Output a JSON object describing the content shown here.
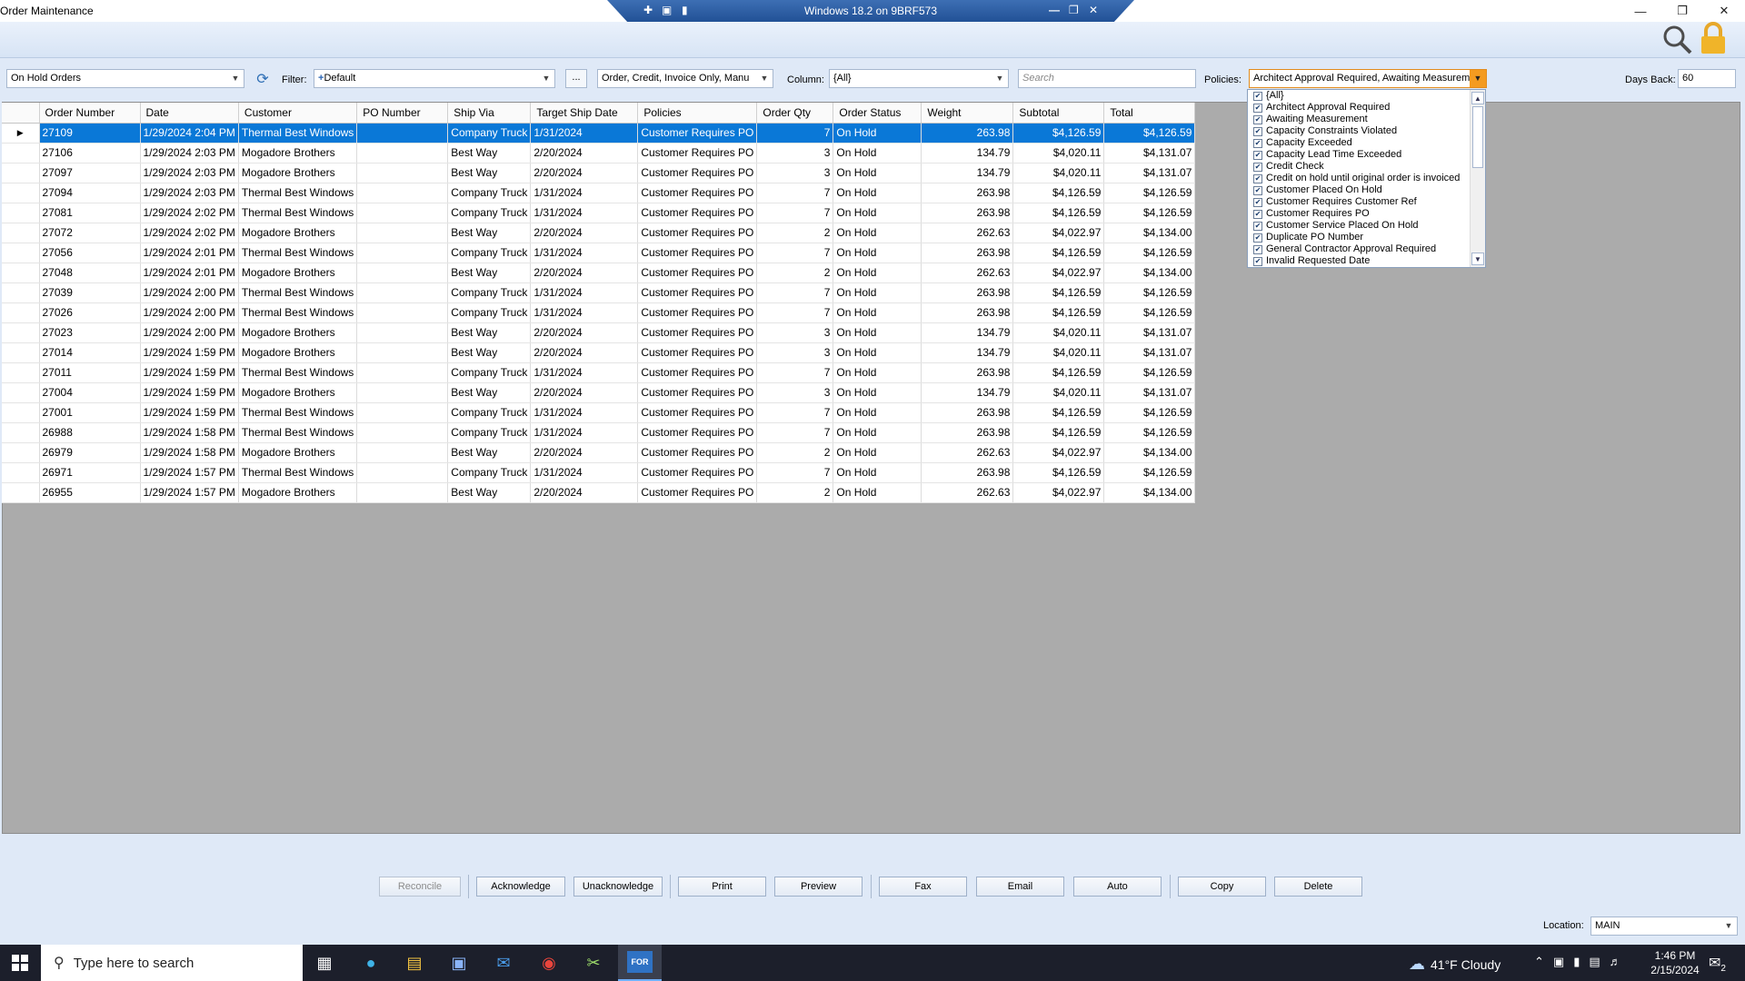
{
  "window": {
    "title": "Order Maintenance"
  },
  "remote_bar": {
    "title": "Windows 18.2 on 9BRF573"
  },
  "toolbar": {
    "view": "On Hold Orders",
    "filter_label": "Filter:",
    "filter_value": "Default",
    "ellipsis": "...",
    "types": "Order, Credit, Invoice Only, Manu",
    "column_label": "Column:",
    "column_value": "{All}",
    "search_placeholder": "Search",
    "policies_label": "Policies:",
    "policies_value": "Architect Approval Required, Awaiting Measurement",
    "days_back_label": "Days Back:",
    "days_back_value": "60"
  },
  "policies_list": [
    "{All}",
    "Architect Approval Required",
    "Awaiting Measurement",
    "Capacity Constraints Violated",
    "Capacity Exceeded",
    "Capacity Lead Time Exceeded",
    "Credit Check",
    "Credit on hold until original order is invoiced",
    "Customer Placed On Hold",
    "Customer Requires Customer Ref",
    "Customer Requires PO",
    "Customer Service Placed On Hold",
    "Duplicate PO Number",
    "General Contractor Approval Required",
    "Invalid Requested Date"
  ],
  "grid": {
    "columns": [
      "Order Number",
      "Date",
      "Customer",
      "PO Number",
      "Ship Via",
      "Target Ship Date",
      "Policies",
      "Order Qty",
      "Order Status",
      "Weight",
      "Subtotal",
      "Total"
    ],
    "rows": [
      [
        "27109",
        "1/29/2024 2:04 PM",
        "Thermal Best Windows",
        "",
        "Company Truck",
        "1/31/2024",
        "Customer Requires PO",
        "7",
        "On Hold",
        "263.98",
        "$4,126.59",
        "$4,126.59"
      ],
      [
        "27106",
        "1/29/2024 2:03 PM",
        "Mogadore Brothers",
        "",
        "Best Way",
        "2/20/2024",
        "Customer Requires PO",
        "3",
        "On Hold",
        "134.79",
        "$4,020.11",
        "$4,131.07"
      ],
      [
        "27097",
        "1/29/2024 2:03 PM",
        "Mogadore Brothers",
        "",
        "Best Way",
        "2/20/2024",
        "Customer Requires PO",
        "3",
        "On Hold",
        "134.79",
        "$4,020.11",
        "$4,131.07"
      ],
      [
        "27094",
        "1/29/2024 2:03 PM",
        "Thermal Best Windows",
        "",
        "Company Truck",
        "1/31/2024",
        "Customer Requires PO",
        "7",
        "On Hold",
        "263.98",
        "$4,126.59",
        "$4,126.59"
      ],
      [
        "27081",
        "1/29/2024 2:02 PM",
        "Thermal Best Windows",
        "",
        "Company Truck",
        "1/31/2024",
        "Customer Requires PO",
        "7",
        "On Hold",
        "263.98",
        "$4,126.59",
        "$4,126.59"
      ],
      [
        "27072",
        "1/29/2024 2:02 PM",
        "Mogadore Brothers",
        "",
        "Best Way",
        "2/20/2024",
        "Customer Requires PO",
        "2",
        "On Hold",
        "262.63",
        "$4,022.97",
        "$4,134.00"
      ],
      [
        "27056",
        "1/29/2024 2:01 PM",
        "Thermal Best Windows",
        "",
        "Company Truck",
        "1/31/2024",
        "Customer Requires PO",
        "7",
        "On Hold",
        "263.98",
        "$4,126.59",
        "$4,126.59"
      ],
      [
        "27048",
        "1/29/2024 2:01 PM",
        "Mogadore Brothers",
        "",
        "Best Way",
        "2/20/2024",
        "Customer Requires PO",
        "2",
        "On Hold",
        "262.63",
        "$4,022.97",
        "$4,134.00"
      ],
      [
        "27039",
        "1/29/2024 2:00 PM",
        "Thermal Best Windows",
        "",
        "Company Truck",
        "1/31/2024",
        "Customer Requires PO",
        "7",
        "On Hold",
        "263.98",
        "$4,126.59",
        "$4,126.59"
      ],
      [
        "27026",
        "1/29/2024 2:00 PM",
        "Thermal Best Windows",
        "",
        "Company Truck",
        "1/31/2024",
        "Customer Requires PO",
        "7",
        "On Hold",
        "263.98",
        "$4,126.59",
        "$4,126.59"
      ],
      [
        "27023",
        "1/29/2024 2:00 PM",
        "Mogadore Brothers",
        "",
        "Best Way",
        "2/20/2024",
        "Customer Requires PO",
        "3",
        "On Hold",
        "134.79",
        "$4,020.11",
        "$4,131.07"
      ],
      [
        "27014",
        "1/29/2024 1:59 PM",
        "Mogadore Brothers",
        "",
        "Best Way",
        "2/20/2024",
        "Customer Requires PO",
        "3",
        "On Hold",
        "134.79",
        "$4,020.11",
        "$4,131.07"
      ],
      [
        "27011",
        "1/29/2024 1:59 PM",
        "Thermal Best Windows",
        "",
        "Company Truck",
        "1/31/2024",
        "Customer Requires PO",
        "7",
        "On Hold",
        "263.98",
        "$4,126.59",
        "$4,126.59"
      ],
      [
        "27004",
        "1/29/2024 1:59 PM",
        "Mogadore Brothers",
        "",
        "Best Way",
        "2/20/2024",
        "Customer Requires PO",
        "3",
        "On Hold",
        "134.79",
        "$4,020.11",
        "$4,131.07"
      ],
      [
        "27001",
        "1/29/2024 1:59 PM",
        "Thermal Best Windows",
        "",
        "Company Truck",
        "1/31/2024",
        "Customer Requires PO",
        "7",
        "On Hold",
        "263.98",
        "$4,126.59",
        "$4,126.59"
      ],
      [
        "26988",
        "1/29/2024 1:58 PM",
        "Thermal Best Windows",
        "",
        "Company Truck",
        "1/31/2024",
        "Customer Requires PO",
        "7",
        "On Hold",
        "263.98",
        "$4,126.59",
        "$4,126.59"
      ],
      [
        "26979",
        "1/29/2024 1:58 PM",
        "Mogadore Brothers",
        "",
        "Best Way",
        "2/20/2024",
        "Customer Requires PO",
        "2",
        "On Hold",
        "262.63",
        "$4,022.97",
        "$4,134.00"
      ],
      [
        "26971",
        "1/29/2024 1:57 PM",
        "Thermal Best Windows",
        "",
        "Company Truck",
        "1/31/2024",
        "Customer Requires PO",
        "7",
        "On Hold",
        "263.98",
        "$4,126.59",
        "$4,126.59"
      ],
      [
        "26955",
        "1/29/2024 1:57 PM",
        "Mogadore Brothers",
        "",
        "Best Way",
        "2/20/2024",
        "Customer Requires PO",
        "2",
        "On Hold",
        "262.63",
        "$4,022.97",
        "$4,134.00"
      ]
    ]
  },
  "actions": {
    "reconcile": "Reconcile",
    "acknowledge": "Acknowledge",
    "unacknowledge": "Unacknowledge",
    "print": "Print",
    "preview": "Preview",
    "fax": "Fax",
    "email": "Email",
    "auto": "Auto",
    "copy": "Copy",
    "delete": "Delete"
  },
  "location": {
    "label": "Location:",
    "value": "MAIN"
  },
  "taskbar": {
    "search_placeholder": "Type here to search",
    "weather": "41°F  Cloudy",
    "time": "1:46 PM",
    "date": "2/15/2024",
    "notifications": "2",
    "active_app": "FOR"
  },
  "colors": {
    "selection": "#0a78d7",
    "accent": "#f49b20",
    "taskbar": "#1c1f2b"
  }
}
